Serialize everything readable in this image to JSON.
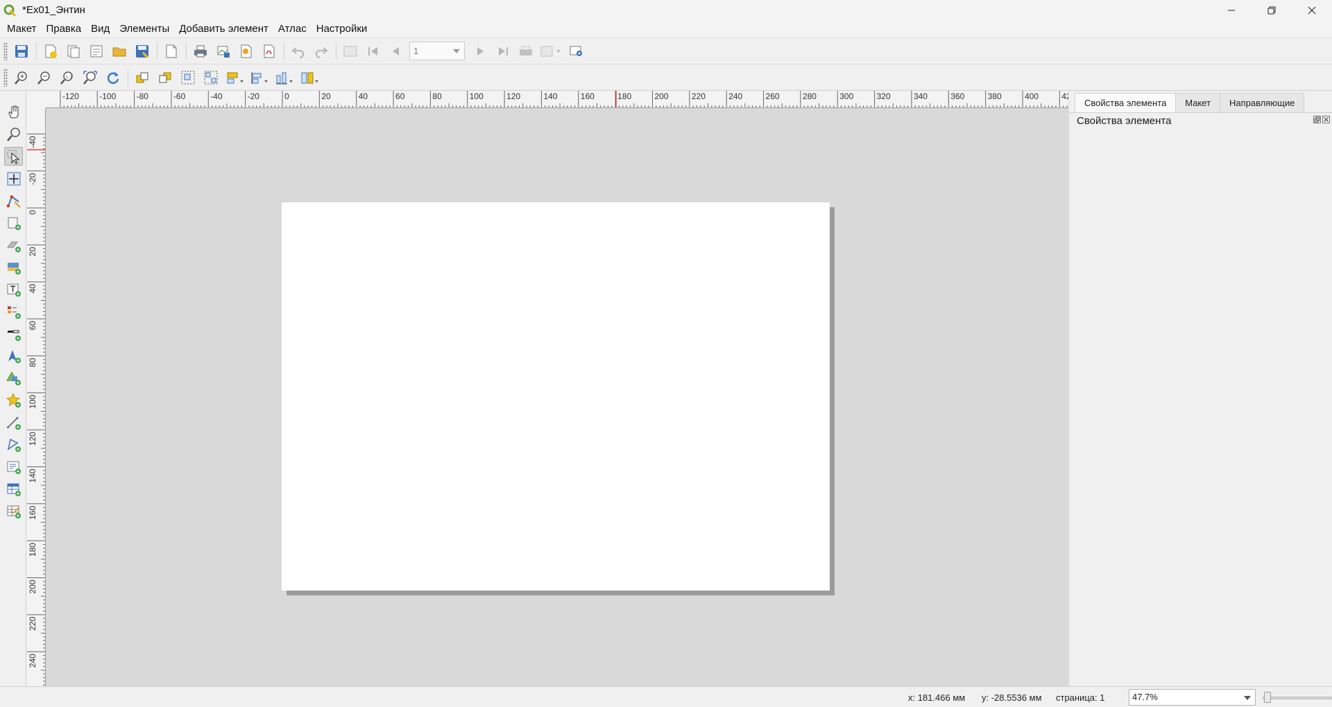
{
  "window": {
    "title": "*Ex01_Энтин"
  },
  "menu": [
    "Макет",
    "Правка",
    "Вид",
    "Элементы",
    "Добавить элемент",
    "Атлас",
    "Настройки"
  ],
  "atlas": {
    "page_value": "1"
  },
  "ruler": {
    "h_labels": [
      "-120",
      "-100",
      "-80",
      "-60",
      "-40",
      "-20",
      "0",
      "20",
      "40",
      "60",
      "80",
      "100",
      "120",
      "140",
      "160",
      "180",
      "200",
      "220",
      "240",
      "260",
      "280",
      "300",
      "320",
      "340",
      "360",
      "380",
      "400",
      "42"
    ],
    "v_labels": [
      "-40",
      "-20",
      "0",
      "20",
      "40",
      "60",
      "80",
      "100",
      "120",
      "140",
      "160",
      "180",
      "200",
      "220",
      "240"
    ]
  },
  "dock": {
    "tabs": [
      "Свойства элемента",
      "Макет",
      "Направляющие"
    ],
    "active_tab": 0,
    "panel_title": "Свойства элемента"
  },
  "status": {
    "x": "x: 181.466 мм",
    "y": "y: -28.5536 мм",
    "page": "страница: 1",
    "zoom": "47.7%"
  },
  "colors": {
    "canvas": "#d9d9d9",
    "page": "#ffffff",
    "page_shadow": "#9b9b9b",
    "cursor_marker": "#e02020",
    "accent_icon": "#2f6fb5"
  },
  "icons": {
    "toolbar_main": [
      "save-icon",
      "new-layout-icon",
      "duplicate-layout-icon",
      "layout-manager-icon",
      "open-template-icon",
      "save-template-icon",
      "add-pages-icon",
      "print-icon",
      "export-image-icon",
      "export-svg-icon",
      "export-pdf-icon",
      "undo-icon",
      "redo-icon",
      "atlas-preview-icon",
      "first-feature-icon",
      "previous-feature-icon",
      "next-feature-icon",
      "last-feature-icon",
      "atlas-print-icon",
      "atlas-export-icon",
      "atlas-settings-icon"
    ],
    "toolbar_layout": [
      "zoom-in-icon",
      "zoom-out-icon",
      "zoom-actual-icon",
      "zoom-full-icon",
      "refresh-icon",
      "raise-items-icon",
      "lower-items-icon",
      "group-items-icon",
      "ungroup-items-icon",
      "align-left-icon",
      "align-top-icon",
      "distribute-icon",
      "resize-icon"
    ],
    "tools": [
      "pan-icon",
      "zoom-tool-icon",
      "select-move-icon",
      "move-content-icon",
      "edit-nodes-icon",
      "add-map-icon",
      "add-3d-map-icon",
      "add-picture-icon",
      "add-label-icon",
      "add-legend-icon",
      "add-scalebar-icon",
      "add-north-arrow-icon",
      "add-shape-icon",
      "add-marker-icon",
      "add-polyline-icon",
      "add-polygon-icon",
      "add-html-icon",
      "add-attribute-table-icon",
      "add-fixed-table-icon"
    ]
  }
}
